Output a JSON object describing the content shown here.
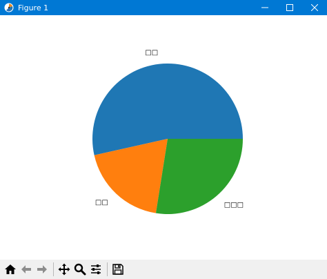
{
  "window": {
    "title": "Figure 1"
  },
  "toolbar": {
    "buttons": [
      {
        "name": "home-icon"
      },
      {
        "name": "back-arrow-icon"
      },
      {
        "name": "forward-arrow-icon"
      },
      {
        "name": "pan-icon"
      },
      {
        "name": "zoom-icon"
      },
      {
        "name": "configure-subplots-icon"
      },
      {
        "name": "save-icon"
      }
    ]
  },
  "chart_data": {
    "type": "pie",
    "labels": [
      "□□",
      "□□",
      "□□□"
    ],
    "values": [
      53.5,
      19.0,
      27.5
    ],
    "colors": [
      "#1f77b4",
      "#ff7f0e",
      "#2ca02c"
    ],
    "start_angle_deg": 0,
    "legend": "none",
    "title": ""
  },
  "colors": {
    "titlebar": "#0078d4",
    "toolbar": "#f0f0f0"
  }
}
